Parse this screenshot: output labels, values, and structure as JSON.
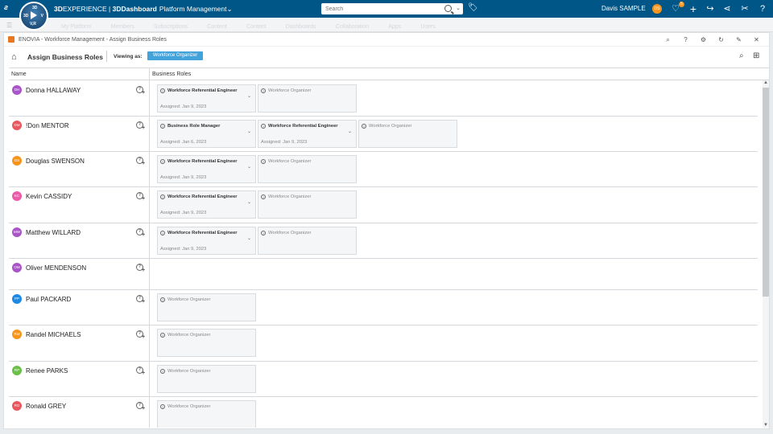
{
  "topbar": {
    "compass": {
      "n": "3D",
      "w": "3D",
      "e": "V",
      "s": "V,R"
    },
    "brand_prefix": "3D",
    "brand_main": "EXPERIENCE",
    "brand_sep": " | ",
    "brand_dashboard": "3DDashboard",
    "brand_platform": "Platform Management",
    "brand_chevron": "⌄",
    "search_placeholder": "Search",
    "user_name": "Davis SAMPLE",
    "user_initials": "DS",
    "notifications_count": "5"
  },
  "subbar": {
    "tabs": [
      "My Platform",
      "Members",
      "Subscriptions",
      "Content",
      "Content",
      "Dashboards",
      "Collaboration",
      "Apps",
      "Users"
    ]
  },
  "panel": {
    "title": "ENOVIA - Workforce Management - Assign Business Roles"
  },
  "toolbar": {
    "page_title": "Assign Business Roles",
    "viewing_label": "Viewing as:",
    "viewing_role": "Workforce Organizer"
  },
  "grid": {
    "header_name": "Name",
    "header_roles": "Business Roles",
    "rows": [
      {
        "initials": "DH",
        "color": "#a855c8",
        "name": "Donna HALLAWAY",
        "roles": [
          {
            "name": "Workforce Referential Engineer",
            "assigned": "Assigned:  Jan 9, 2023"
          },
          {
            "name": "Workforce Organizer",
            "assigned": ""
          }
        ]
      },
      {
        "initials": "DM",
        "color": "#e8585e",
        "name": "!Don MENTOR",
        "roles": [
          {
            "name": "Business Role Manager",
            "assigned": "Assigned:  Jan 6, 2023"
          },
          {
            "name": "Workforce Referential Engineer",
            "assigned": "Assigned:  Jan 9, 2023"
          },
          {
            "name": "Workforce Organizer",
            "assigned": ""
          }
        ]
      },
      {
        "initials": "DS",
        "color": "#f7941d",
        "name": "Douglas SWENSON",
        "roles": [
          {
            "name": "Workforce Referential Engineer",
            "assigned": "Assigned:  Jan 9, 2023"
          },
          {
            "name": "Workforce Organizer",
            "assigned": ""
          }
        ]
      },
      {
        "initials": "KC",
        "color": "#ec5ba9",
        "name": "Kevin CASSIDY",
        "roles": [
          {
            "name": "Workforce Referential Engineer",
            "assigned": "Assigned:  Jan 9, 2023"
          },
          {
            "name": "Workforce Organizer",
            "assigned": ""
          }
        ]
      },
      {
        "initials": "MW",
        "color": "#a855c8",
        "name": "Matthew WILLARD",
        "roles": [
          {
            "name": "Workforce Referential Engineer",
            "assigned": "Assigned:  Jan 9, 2023"
          },
          {
            "name": "Workforce Organizer",
            "assigned": ""
          }
        ]
      },
      {
        "initials": "OM",
        "color": "#a855c8",
        "name": "Oliver MENDENSON",
        "roles": []
      },
      {
        "initials": "PP",
        "color": "#1e88e5",
        "name": "Paul PACKARD",
        "roles": [
          {
            "name": "Workforce Organizer",
            "assigned": ""
          }
        ]
      },
      {
        "initials": "RM",
        "color": "#f7941d",
        "name": "Randel MICHAELS",
        "roles": [
          {
            "name": "Workforce Organizer",
            "assigned": ""
          }
        ]
      },
      {
        "initials": "RP",
        "color": "#6cc04a",
        "name": "Renee PARKS",
        "roles": [
          {
            "name": "Workforce Organizer",
            "assigned": ""
          }
        ]
      },
      {
        "initials": "RG",
        "color": "#e8585e",
        "name": "Ronald GREY",
        "roles": [
          {
            "name": "Workforce Organizer",
            "assigned": ""
          }
        ]
      }
    ]
  }
}
